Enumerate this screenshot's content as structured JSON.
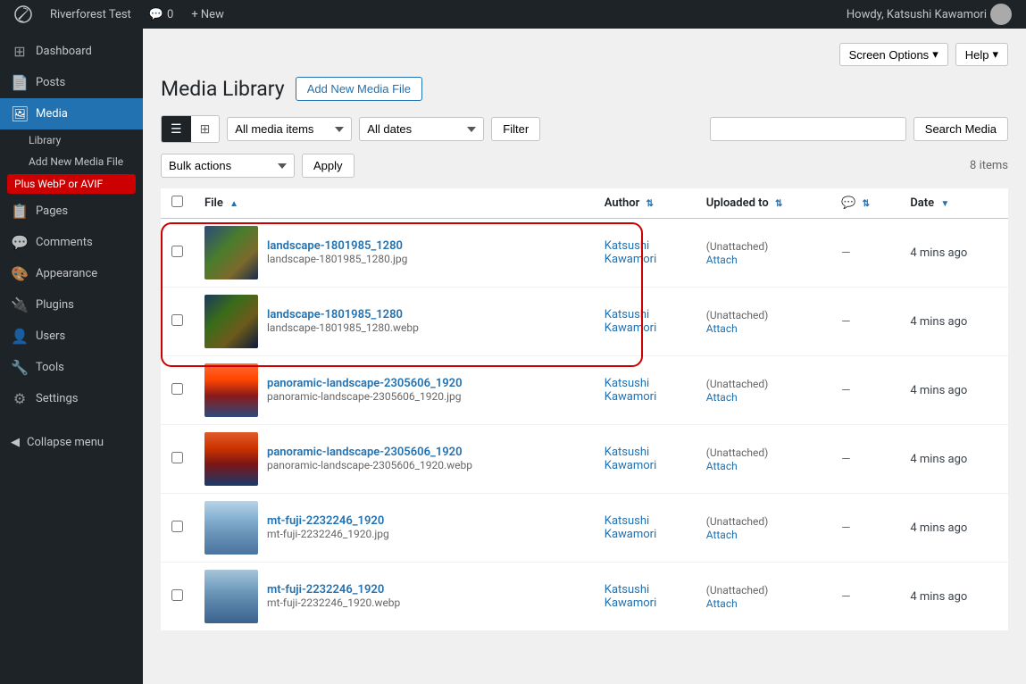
{
  "adminbar": {
    "wp_logo": "⊞",
    "site_name": "Riverforest Test",
    "comments_label": "Comments",
    "comments_count": "0",
    "new_label": "+ New",
    "howdy": "Howdy, Katsushi Kawamori"
  },
  "sidebar": {
    "items": [
      {
        "id": "dashboard",
        "label": "Dashboard",
        "icon": "⊞"
      },
      {
        "id": "posts",
        "label": "Posts",
        "icon": "📄"
      },
      {
        "id": "media",
        "label": "Media",
        "icon": "🖼",
        "active": true
      },
      {
        "id": "pages",
        "label": "Pages",
        "icon": "📋"
      },
      {
        "id": "comments",
        "label": "Comments",
        "icon": "💬"
      },
      {
        "id": "appearance",
        "label": "Appearance",
        "icon": "🎨"
      },
      {
        "id": "plugins",
        "label": "Plugins",
        "icon": "🔌"
      },
      {
        "id": "users",
        "label": "Users",
        "icon": "👤"
      },
      {
        "id": "tools",
        "label": "Tools",
        "icon": "🔧"
      },
      {
        "id": "settings",
        "label": "Settings",
        "icon": "⚙"
      }
    ],
    "media_submenu": [
      {
        "id": "library",
        "label": "Library"
      },
      {
        "id": "add-new",
        "label": "Add New Media File"
      },
      {
        "id": "plus-webp",
        "label": "Plus WebP or AVIF",
        "highlighted": true
      }
    ],
    "collapse_label": "Collapse menu"
  },
  "header": {
    "title": "Media Library",
    "add_new_label": "Add New Media File",
    "screen_options_label": "Screen Options",
    "help_label": "Help"
  },
  "toolbar": {
    "view_list_label": "☰",
    "view_grid_label": "⊞",
    "filter_type_options": [
      "All media items"
    ],
    "filter_type_value": "All media items",
    "filter_date_options": [
      "All dates"
    ],
    "filter_date_value": "All dates",
    "filter_btn_label": "Filter",
    "search_placeholder": "",
    "search_btn_label": "Search Media"
  },
  "bulk": {
    "actions_label": "Bulk actions",
    "apply_label": "Apply",
    "items_count": "8 items"
  },
  "table": {
    "headers": [
      {
        "id": "checkbox",
        "label": ""
      },
      {
        "id": "file",
        "label": "File",
        "sort": "asc"
      },
      {
        "id": "author",
        "label": "Author",
        "sort": "none"
      },
      {
        "id": "uploaded_to",
        "label": "Uploaded to",
        "sort": "none"
      },
      {
        "id": "comment",
        "label": "💬",
        "sort": "none"
      },
      {
        "id": "date",
        "label": "Date",
        "sort": "desc"
      }
    ],
    "rows": [
      {
        "id": "row1",
        "thumb_class": "thumb-landscape-jpg",
        "file_name": "landscape-1801985_1280",
        "file_subname": "landscape-1801985_1280.jpg",
        "author": "Katsushi Kawamori",
        "uploaded_to": "(Unattached)",
        "attach": "Attach",
        "comments": "—",
        "date": "4 mins ago",
        "highlighted": true
      },
      {
        "id": "row2",
        "thumb_class": "thumb-landscape-webp",
        "file_name": "landscape-1801985_1280",
        "file_subname": "landscape-1801985_1280.webp",
        "author": "Katsushi Kawamori",
        "uploaded_to": "(Unattached)",
        "attach": "Attach",
        "comments": "—",
        "date": "4 mins ago",
        "highlighted": true
      },
      {
        "id": "row3",
        "thumb_class": "thumb-panoramic-jpg",
        "file_name": "panoramic-landscape-2305606_1920",
        "file_subname": "panoramic-landscape-2305606_1920.jpg",
        "author": "Katsushi Kawamori",
        "uploaded_to": "(Unattached)",
        "attach": "Attach",
        "comments": "—",
        "date": "4 mins ago",
        "highlighted": false
      },
      {
        "id": "row4",
        "thumb_class": "thumb-panoramic-webp",
        "file_name": "panoramic-landscape-2305606_1920",
        "file_subname": "panoramic-landscape-2305606_1920.webp",
        "author": "Katsushi Kawamori",
        "uploaded_to": "(Unattached)",
        "attach": "Attach",
        "comments": "—",
        "date": "4 mins ago",
        "highlighted": false
      },
      {
        "id": "row5",
        "thumb_class": "thumb-fuji-jpg",
        "file_name": "mt-fuji-2232246_1920",
        "file_subname": "mt-fuji-2232246_1920.jpg",
        "author": "Katsushi Kawamori",
        "uploaded_to": "(Unattached)",
        "attach": "Attach",
        "comments": "—",
        "date": "4 mins ago",
        "highlighted": false
      },
      {
        "id": "row6",
        "thumb_class": "thumb-fuji-webp",
        "file_name": "mt-fuji-2232246_1920",
        "file_subname": "mt-fuji-2232246_1920.webp",
        "author": "Katsushi Kawamori",
        "uploaded_to": "(Unattached)",
        "attach": "Attach",
        "comments": "—",
        "date": "4 mins ago",
        "highlighted": false
      }
    ]
  }
}
